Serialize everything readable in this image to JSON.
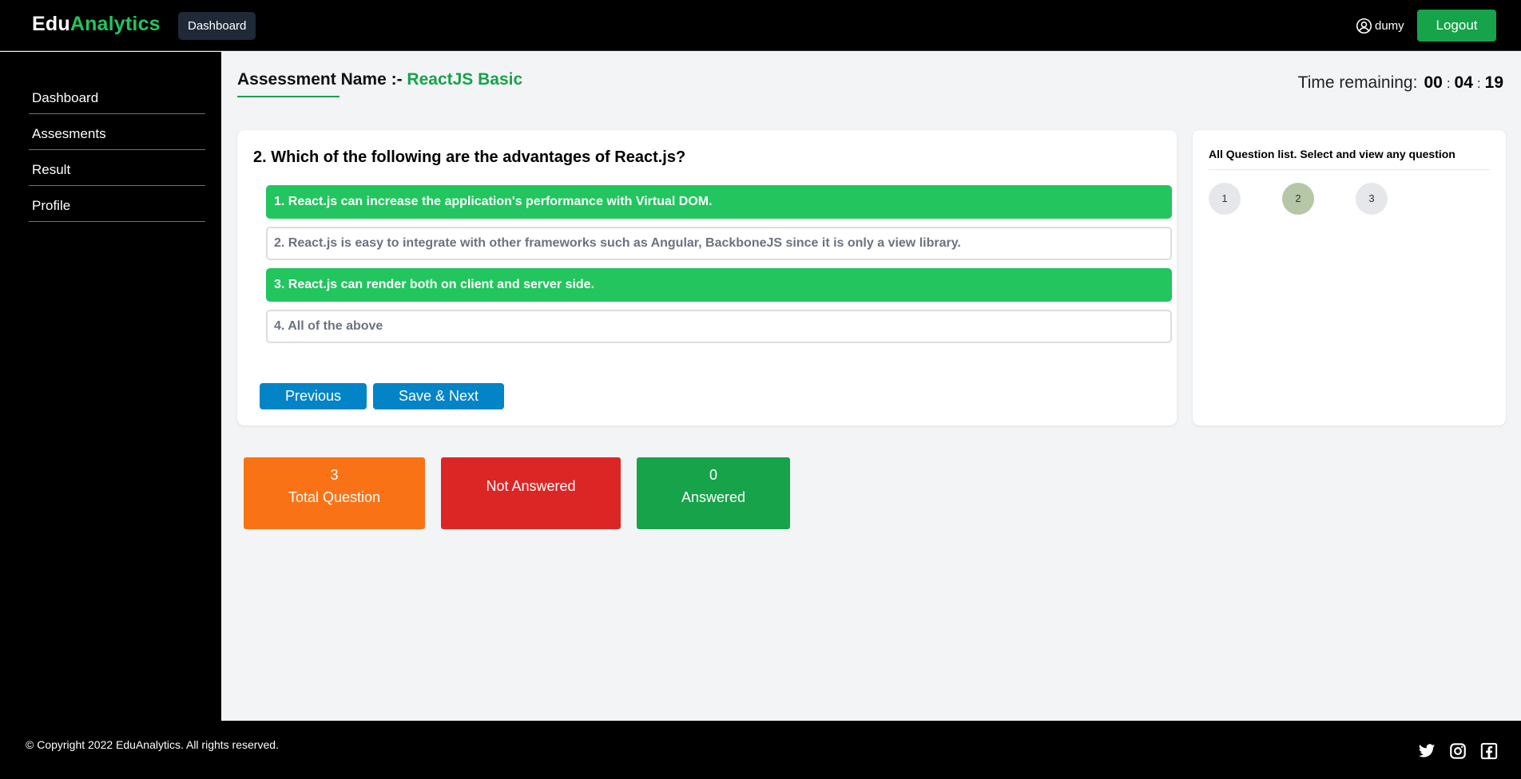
{
  "header": {
    "brand_part1": "Edu",
    "brand_part2": "Analytics",
    "nav_button": "Dashboard",
    "username": "dumy",
    "logout_label": "Logout"
  },
  "sidebar": {
    "items": [
      {
        "label": "Dashboard"
      },
      {
        "label": "Assesments"
      },
      {
        "label": "Result"
      },
      {
        "label": "Profile"
      }
    ]
  },
  "assessment": {
    "label": "Assessment Name :- ",
    "name": "ReactJS Basic"
  },
  "timer": {
    "label": "Time remaining:",
    "hours": "00",
    "minutes": "04",
    "seconds": "19",
    "separator": ":"
  },
  "question": {
    "text": "2. Which of the following are the advantages of React.js?",
    "options": [
      {
        "text": "1. React.js can increase the application's performance with Virtual DOM.",
        "selected": true
      },
      {
        "text": "2. React.js is easy to integrate with other frameworks such as Angular, BackboneJS since it is only a view library.",
        "selected": false
      },
      {
        "text": "3. React.js can render both on client and server side.",
        "selected": true
      },
      {
        "text": "4. All of the above",
        "selected": false
      }
    ],
    "previous_label": "Previous",
    "next_label": "Save & Next"
  },
  "question_list": {
    "title": "All Question list. Select and view any question",
    "numbers": [
      "1",
      "2",
      "3"
    ],
    "current": "2"
  },
  "stats": {
    "total_value": "3",
    "total_label": "Total Question",
    "not_answered_label": "Not Answered",
    "answered_value": "0",
    "answered_label": "Answered"
  },
  "footer": {
    "copyright": "© Copyright 2022 EduAnalytics. All rights reserved.",
    "social_icons": [
      "twitter-icon",
      "instagram-icon",
      "facebook-icon"
    ]
  },
  "colors": {
    "accent_green": "#22c55e",
    "logout_green": "#16a34a",
    "button_blue": "#0284c7",
    "total_orange": "#f97316",
    "not_answered_red": "#dc2626",
    "answered_green": "#16a34a"
  }
}
